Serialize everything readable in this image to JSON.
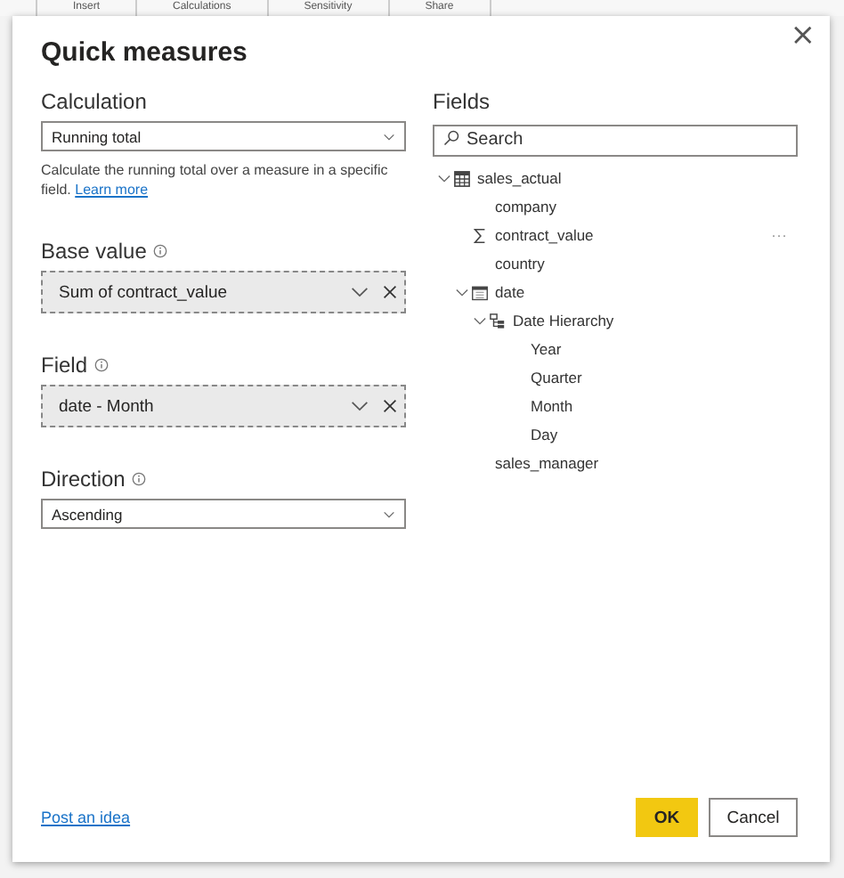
{
  "ribbon_tabs": [
    "Insert",
    "Calculations",
    "Sensitivity",
    "Share"
  ],
  "dialog": {
    "title": "Quick measures",
    "close": "×"
  },
  "settings": [
    {
      "label": "Calculation",
      "info": false,
      "kind": "select",
      "value": "Running total",
      "description": "Calculate the running total over a measure in a specific field.",
      "link": "Learn more"
    },
    {
      "label": "Base value",
      "info": true,
      "kind": "well",
      "value": "Sum of contract_value"
    },
    {
      "label": "Field",
      "info": true,
      "kind": "well",
      "value": "date - Month"
    },
    {
      "label": "Direction",
      "info": true,
      "kind": "select",
      "value": "Ascending"
    }
  ],
  "fields": {
    "heading": "Fields",
    "search": {
      "placeholder": "Search"
    },
    "tree": [
      {
        "label": "sales_actual",
        "kind": "table",
        "expanded": true,
        "children": [
          {
            "label": "company"
          },
          {
            "label": "contract_value",
            "kind": "measure",
            "more": "···"
          },
          {
            "label": "country"
          },
          {
            "label": "date",
            "kind": "calendar",
            "expanded": true,
            "children": [
              {
                "label": "Date Hierarchy",
                "kind": "hierarchy",
                "expanded": true,
                "children": [
                  {
                    "label": "Year"
                  },
                  {
                    "label": "Quarter"
                  },
                  {
                    "label": "Month"
                  },
                  {
                    "label": "Day"
                  }
                ]
              }
            ]
          },
          {
            "label": "sales_manager"
          }
        ]
      }
    ]
  },
  "footer": {
    "link": "Post an idea",
    "buttons": [
      {
        "label": "OK",
        "kind": "primary"
      },
      {
        "label": "Cancel",
        "kind": "secondary"
      }
    ]
  }
}
